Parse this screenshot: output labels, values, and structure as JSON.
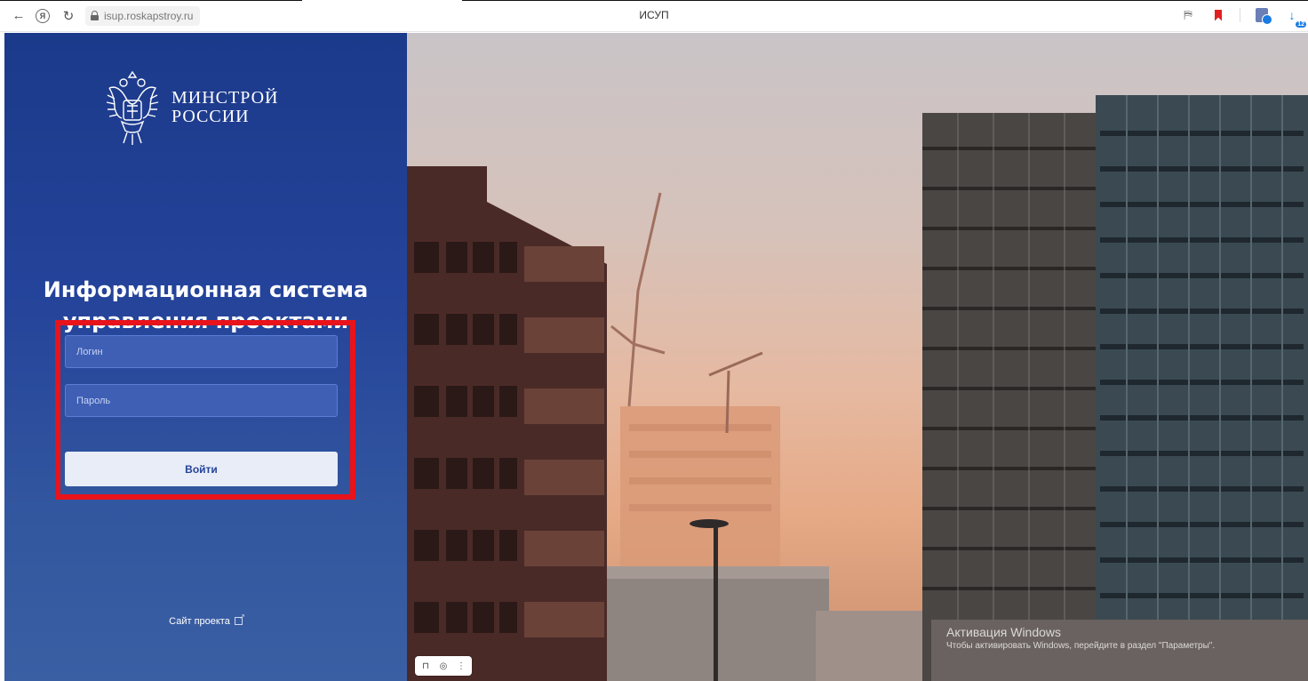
{
  "browser": {
    "url": "isup.roskapstroy.ru",
    "tab_title": "ИСУП"
  },
  "logo": {
    "line1": "МИНСТРОЙ",
    "line2": "РОССИИ"
  },
  "system_title": {
    "line1": "Информационная система",
    "line2": "управления проектами"
  },
  "login_form": {
    "login_placeholder": "Логин",
    "password_placeholder": "Пароль",
    "submit_label": "Войти"
  },
  "footer": {
    "project_link": "Сайт проекта"
  },
  "watermark": {
    "title": "Активация Windows",
    "subtitle": "Чтобы активировать Windows, перейдите в раздел \"Параметры\"."
  },
  "colors": {
    "panel_top": "#1c3a8a",
    "panel_bottom": "#3a5fa3",
    "highlight_frame": "#e8131b",
    "button_bg": "#e9edf8"
  },
  "icons": [
    "back-arrow-icon",
    "yandex-icon",
    "reload-icon",
    "lock-icon",
    "translate-icon",
    "bookmark-icon",
    "extension-icon",
    "download-icon",
    "external-link-icon",
    "bookmark-tool-icon",
    "screenshot-tool-icon",
    "more-icon"
  ]
}
